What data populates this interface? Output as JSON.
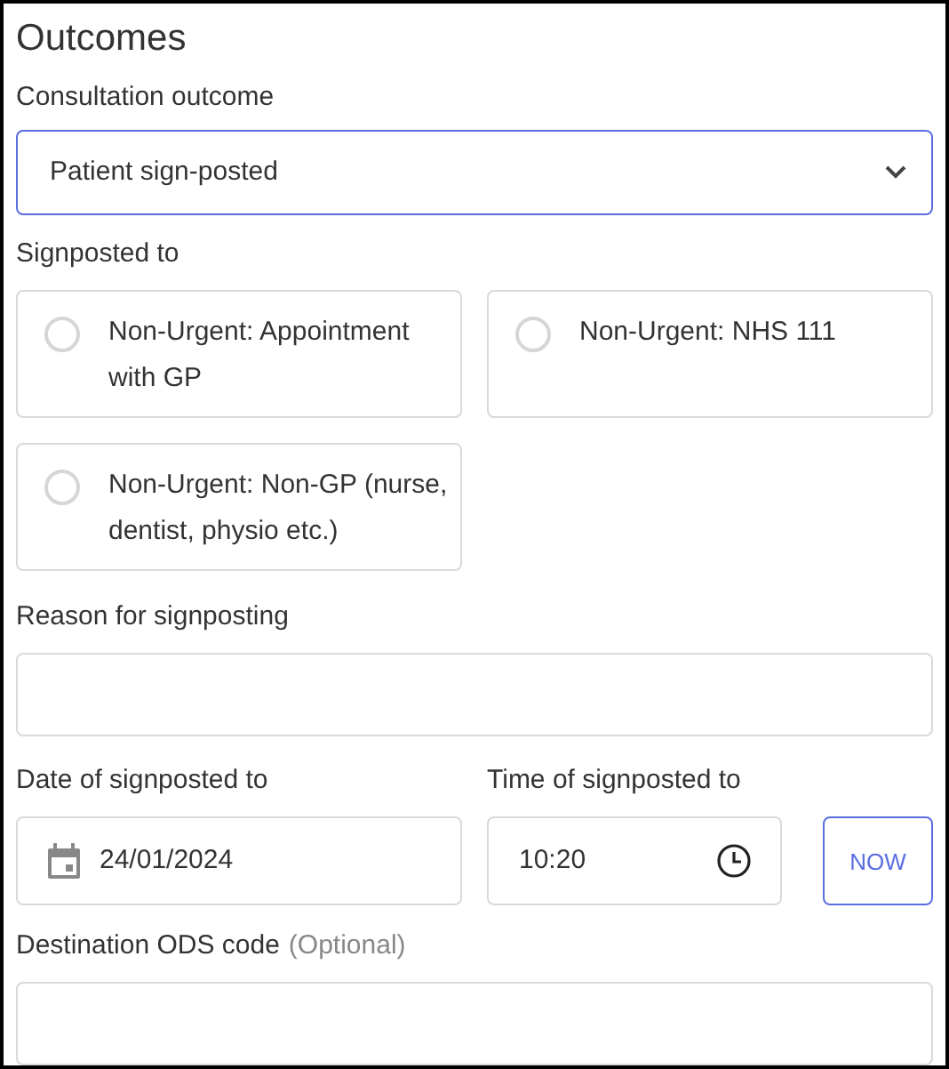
{
  "title": "Outcomes",
  "consultation_outcome": {
    "label": "Consultation outcome",
    "value": "Patient sign-posted"
  },
  "signposted_to": {
    "label": "Signposted to",
    "options": [
      {
        "label": "Non-Urgent: Appointment with GP",
        "selected": false
      },
      {
        "label": "Non-Urgent: NHS 111",
        "selected": false
      },
      {
        "label": "Non-Urgent: Non-GP (nurse, dentist, physio etc.)",
        "selected": false
      }
    ]
  },
  "reason": {
    "label": "Reason for signposting"
  },
  "date": {
    "label": "Date of signposted to",
    "value": "24/01/2024"
  },
  "time": {
    "label": "Time of signposted to",
    "value": "10:20",
    "now_button": "NOW"
  },
  "destination": {
    "label": "Destination ODS code",
    "optional_note": "(Optional)"
  }
}
